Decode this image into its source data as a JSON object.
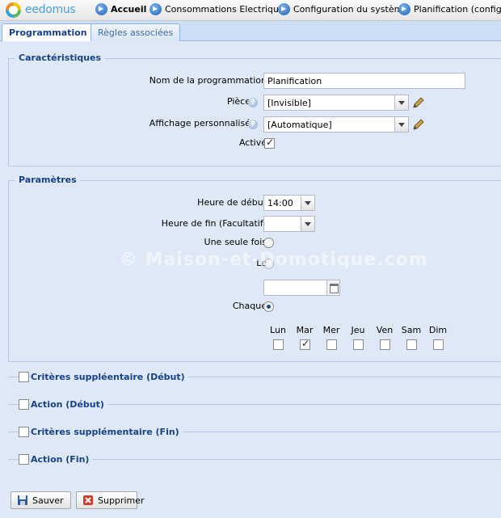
{
  "app": {
    "logo_text": "eedomus"
  },
  "nav": [
    {
      "label": "Accueil"
    },
    {
      "label": "Consommations Electriques"
    },
    {
      "label": "Configuration du système"
    },
    {
      "label": "Planification (configura"
    }
  ],
  "tabs": [
    {
      "label": "Programmation"
    },
    {
      "label": "Règles associées"
    }
  ],
  "characteristics": {
    "legend": "Caractéristiques",
    "name_label": "Nom de la programmation",
    "name_value": "Planification",
    "piece_label": "Pièce",
    "piece_value": "[Invisible]",
    "display_label": "Affichage personnalisé",
    "display_value": "[Automatique]",
    "active_label": "Activé",
    "active_checked": true,
    "help_glyph": "?"
  },
  "parameters": {
    "legend": "Paramètres",
    "start_label": "Heure de début",
    "start_value": "14:00",
    "end_label": "Heure de fin (Facultatif)",
    "end_value": "",
    "once_label": "Une seule fois",
    "on_label": "Le",
    "date_value": "",
    "each_label": "Chaque",
    "days": [
      {
        "label": "Lun",
        "checked": false
      },
      {
        "label": "Mar",
        "checked": true
      },
      {
        "label": "Mer",
        "checked": false
      },
      {
        "label": "Jeu",
        "checked": false
      },
      {
        "label": "Ven",
        "checked": false
      },
      {
        "label": "Sam",
        "checked": false
      },
      {
        "label": "Dim",
        "checked": false
      }
    ]
  },
  "sections": [
    {
      "label": "Critères suppléentaire (Début)"
    },
    {
      "label": "Action (Début)"
    },
    {
      "label": "Critères supplémentaire (Fin)"
    },
    {
      "label": "Action (Fin)"
    }
  ],
  "buttons": {
    "save": "Sauver",
    "delete": "Supprimer"
  },
  "watermark": "© Maison-et-Domotique.com",
  "colors": {
    "panel_bg": "#dfe8f6",
    "legend_text": "#15428b",
    "accent": "#4c9fd6"
  }
}
